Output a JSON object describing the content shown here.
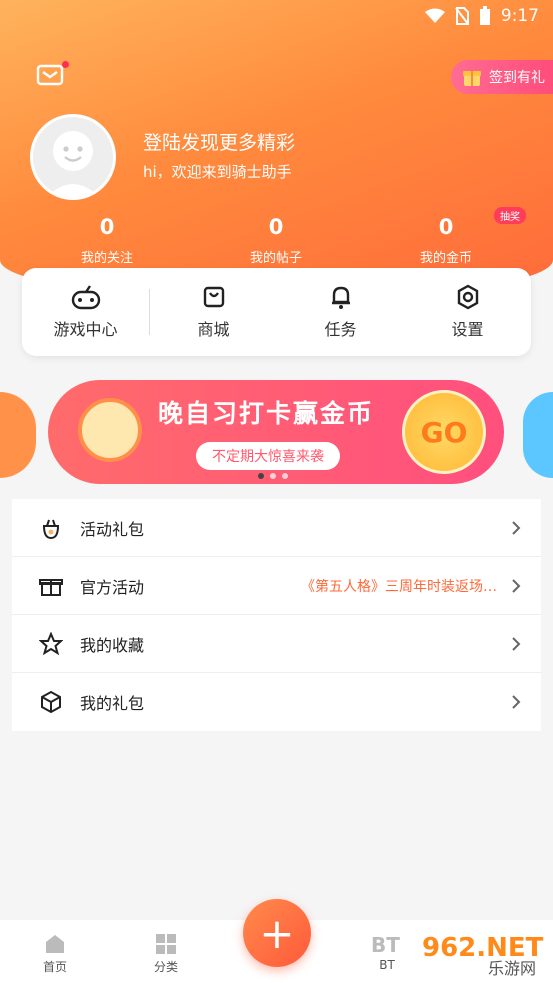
{
  "status": {
    "time": "9:17"
  },
  "header": {
    "sign_in_label": "签到有礼",
    "login_title": "登陆发现更多精彩",
    "login_subtitle": "hi，欢迎来到骑士助手",
    "lottery_badge": "抽奖",
    "stats": [
      {
        "value": "0",
        "label": "我的关注"
      },
      {
        "value": "0",
        "label": "我的帖子"
      },
      {
        "value": "0",
        "label": "我的金币"
      }
    ]
  },
  "quick_menu": [
    {
      "label": "游戏中心",
      "icon": "gamepad-icon"
    },
    {
      "label": "商城",
      "icon": "shopping-bag-icon"
    },
    {
      "label": "任务",
      "icon": "bell-icon"
    },
    {
      "label": "设置",
      "icon": "gear-icon"
    }
  ],
  "banner": {
    "title": "晚自习打卡赢金币",
    "subtitle": "不定期大惊喜来袭",
    "go_label": "GO"
  },
  "list": [
    {
      "label": "活动礼包",
      "icon": "gift-bag-icon",
      "extra": ""
    },
    {
      "label": "官方活动",
      "icon": "gift-box-icon",
      "extra": "《第五人格》三周年时装返场…"
    },
    {
      "label": "我的收藏",
      "icon": "star-icon",
      "extra": ""
    },
    {
      "label": "我的礼包",
      "icon": "package-icon",
      "extra": ""
    }
  ],
  "tabbar": [
    {
      "label": "首页",
      "icon": "home-icon"
    },
    {
      "label": "分类",
      "icon": "grid-icon"
    },
    {
      "label": "BT",
      "icon": "bt-icon"
    }
  ],
  "watermark": {
    "text": "962.NET",
    "sub": "乐游网"
  },
  "colors": {
    "accent": "#ff6a3a",
    "header_start": "#ffb35c",
    "pink": "#ff4d7a"
  }
}
